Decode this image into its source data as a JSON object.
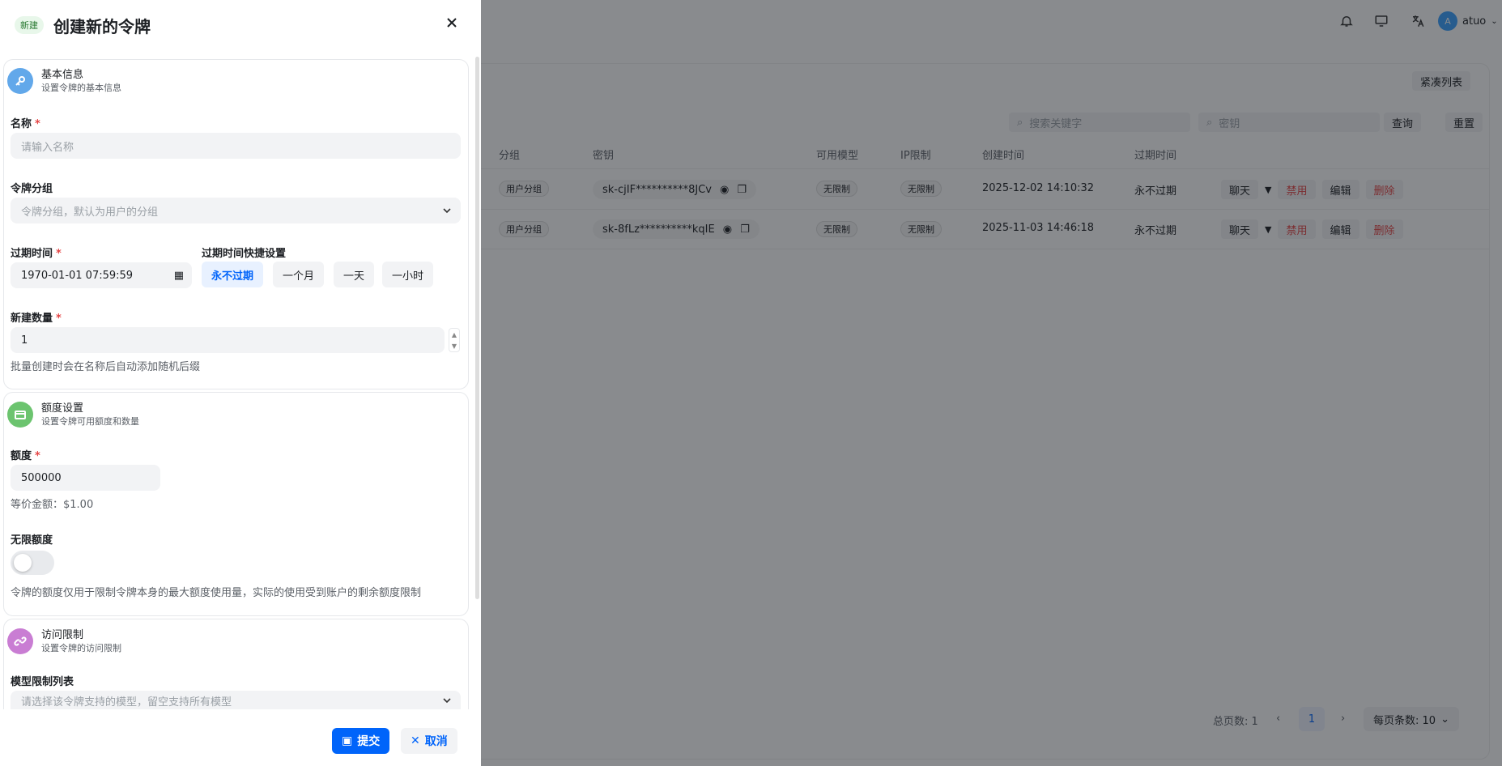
{
  "background": {
    "user_initial": "A",
    "user_name": "atuo",
    "compact_list": "紧凑列表",
    "search_keyword_placeholder": "搜索关键字",
    "search_key_placeholder": "密钥",
    "query_button": "查询",
    "reset_button": "重置",
    "table": {
      "headers": [
        "分组",
        "密钥",
        "可用模型",
        "IP限制",
        "创建时间",
        "过期时间"
      ],
      "rows": [
        {
          "group": "用户分组",
          "key": "sk-cjIF**********8JCv",
          "models": "无限制",
          "ip": "无限制",
          "created": "2025-12-02 14:10:32",
          "expires": "永不过期"
        },
        {
          "group": "用户分组",
          "key": "sk-8fLz**********kqIE",
          "models": "无限制",
          "ip": "无限制",
          "created": "2025-11-03 14:46:18",
          "expires": "永不过期"
        }
      ],
      "actions": {
        "chat": "聊天",
        "disable": "禁用",
        "edit": "编辑",
        "delete": "删除"
      }
    },
    "pagination": {
      "total_label": "总页数: 1",
      "current_page": "1",
      "page_size_label": "每页条数: 10"
    }
  },
  "drawer": {
    "badge": "新建",
    "title": "创建新的令牌",
    "basic": {
      "title": "基本信息",
      "subtitle": "设置令牌的基本信息",
      "name_label": "名称",
      "name_placeholder": "请输入名称",
      "group_label": "令牌分组",
      "group_placeholder": "令牌分组，默认为用户的分组",
      "expire_label": "过期时间",
      "expire_value": "1970-01-01 07:59:59",
      "quick_label": "过期时间快捷设置",
      "quick_options": [
        "永不过期",
        "一个月",
        "一天",
        "一小时"
      ],
      "count_label": "新建数量",
      "count_value": "1",
      "count_hint": "批量创建时会在名称后自动添加随机后缀"
    },
    "quota": {
      "title": "额度设置",
      "subtitle": "设置令牌可用额度和数量",
      "quota_label": "额度",
      "quota_value": "500000",
      "equiv": "等价金额：$1.00",
      "unlimited_label": "无限额度",
      "unlimited_on": false,
      "note": "令牌的额度仅用于限制令牌本身的最大额度使用量，实际的使用受到账户的剩余额度限制"
    },
    "access": {
      "title": "访问限制",
      "subtitle": "设置令牌的访问限制",
      "models_label": "模型限制列表",
      "models_placeholder": "请选择该令牌支持的模型，留空支持所有模型"
    },
    "submit": "提交",
    "cancel": "取消"
  },
  "colors": {
    "accent": "#0064fa",
    "danger": "#e54545",
    "basic_icon": "#62a8ea",
    "quota_icon": "#6cc46f",
    "access_icon": "#c97dd3"
  }
}
